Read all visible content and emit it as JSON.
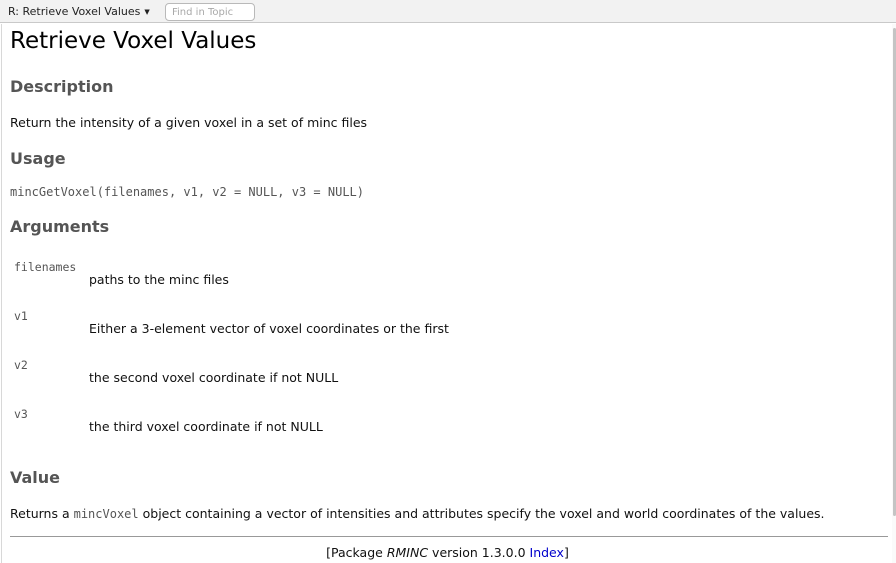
{
  "toolbar": {
    "topic_label": "R: Retrieve Voxel Values",
    "find_placeholder": "Find in Topic"
  },
  "doc": {
    "title": "Retrieve Voxel Values",
    "description_heading": "Description",
    "description_text": "Return the intensity of a given voxel in a set of minc files",
    "usage_heading": "Usage",
    "usage_code": "mincGetVoxel(filenames, v1, v2 = NULL, v3 = NULL)",
    "arguments_heading": "Arguments",
    "arguments": [
      {
        "name": "filenames",
        "desc": "paths to the minc files"
      },
      {
        "name": "v1",
        "desc": "Either a 3-element vector of voxel coordinates or the first"
      },
      {
        "name": "v2",
        "desc": "the second voxel coordinate if not NULL"
      },
      {
        "name": "v3",
        "desc": "the third voxel coordinate if not NULL"
      }
    ],
    "value_heading": "Value",
    "value_prefix": "Returns a ",
    "value_code": "mincVoxel",
    "value_suffix": " object containing a vector of intensities and attributes specify the voxel and world coordinates of the values."
  },
  "footer": {
    "open_bracket": "[Package ",
    "package_name": "RMINC",
    "version_text": " version 1.3.0.0 ",
    "index_link": "Index",
    "close_bracket": "]"
  }
}
